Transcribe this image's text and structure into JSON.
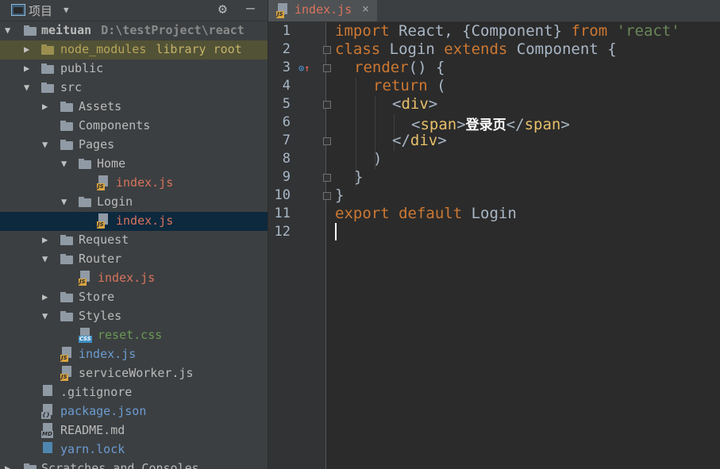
{
  "project_panel": {
    "title": "项目",
    "root": {
      "name": "meituan",
      "path": "D:\\testProject\\react"
    },
    "items": [
      {
        "label": "node_modules",
        "extra": "library root"
      },
      {
        "label": "public"
      },
      {
        "label": "src"
      },
      {
        "label": "Assets"
      },
      {
        "label": "Components"
      },
      {
        "label": "Pages"
      },
      {
        "label": "Home"
      },
      {
        "label": "index.js",
        "badge": "JS"
      },
      {
        "label": "Login"
      },
      {
        "label": "index.js",
        "badge": "JS"
      },
      {
        "label": "Request"
      },
      {
        "label": "Router"
      },
      {
        "label": "index.js",
        "badge": "JS"
      },
      {
        "label": "Store"
      },
      {
        "label": "Styles"
      },
      {
        "label": "reset.css",
        "badge": "CSS"
      },
      {
        "label": "index.js",
        "badge": "JS"
      },
      {
        "label": "serviceWorker.js",
        "badge": "JS"
      },
      {
        "label": ".gitignore"
      },
      {
        "label": "package.json",
        "badge": "{}"
      },
      {
        "label": "README.md",
        "badge": "MD"
      },
      {
        "label": "yarn.lock"
      },
      {
        "label": "Scratches and Consoles"
      }
    ]
  },
  "editor_tab": {
    "label": "index.js",
    "badge": "JS",
    "close": "×"
  },
  "line_numbers": [
    "1",
    "2",
    "3",
    "4",
    "5",
    "6",
    "7",
    "8",
    "9",
    "10",
    "11",
    "12"
  ],
  "code": {
    "l1": {
      "a": "import",
      "b": " React, {Component} ",
      "c": "from",
      "d": " 'react'"
    },
    "l2": {
      "a": "class",
      "b": " Login ",
      "c": "extends",
      "d": " Component {"
    },
    "l3": {
      "a": "render",
      "b": "() {"
    },
    "l4": {
      "a": "return",
      "b": " ("
    },
    "l5": {
      "a": "<",
      "b": "div",
      "c": ">"
    },
    "l6": {
      "a": "<",
      "b": "span",
      "c": ">",
      "d": "登录页",
      "e": "</",
      "f": "span",
      "g": ">"
    },
    "l7": {
      "a": "</",
      "b": "div",
      "c": ">"
    },
    "l8": {
      "a": ")"
    },
    "l9": {
      "a": "}"
    },
    "l10": {
      "a": "}"
    },
    "l11": {
      "a": "export",
      "b": " ",
      "c": "default",
      "d": " Login"
    }
  },
  "colors": {
    "keyword": "#cc7832",
    "string": "#6a8759",
    "tag": "#e8bf6a",
    "file_js": "#d9735d",
    "selection": "#0d293e"
  }
}
